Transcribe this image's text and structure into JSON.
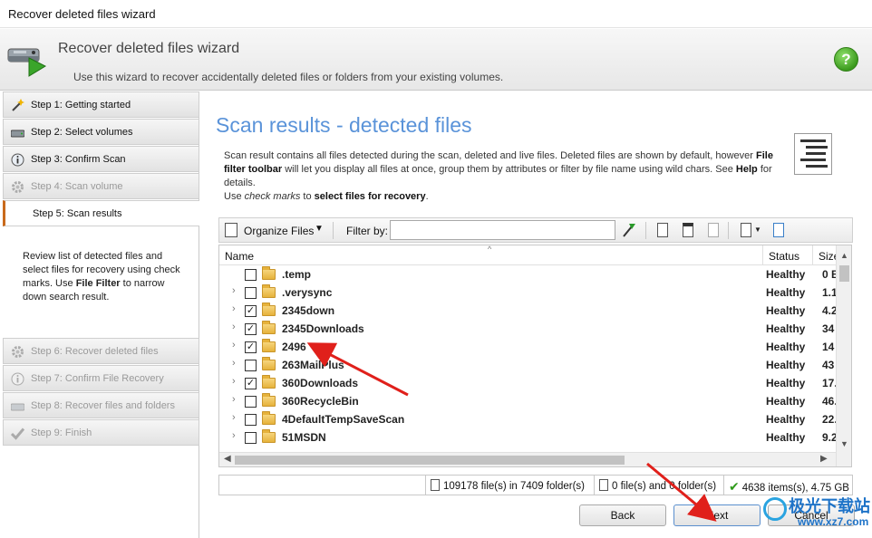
{
  "window": {
    "title": "Recover deleted files wizard"
  },
  "header": {
    "title": "Recover deleted files wizard",
    "subtitle": "Use this wizard to recover accidentally deleted files or folders from your existing volumes."
  },
  "steps": [
    {
      "label": "Step 1: Getting started",
      "state": "done",
      "icon": "wand-icon"
    },
    {
      "label": "Step 2: Select volumes",
      "state": "done",
      "icon": "drive-icon"
    },
    {
      "label": "Step 3: Confirm Scan",
      "state": "done",
      "icon": "info-icon"
    },
    {
      "label": "Step 4: Scan volume",
      "state": "disabled",
      "icon": "gear-icon"
    },
    {
      "label": "Step 5: Scan results",
      "state": "active",
      "icon": ""
    },
    {
      "label": "Step 6: Recover deleted files",
      "state": "disabled",
      "icon": "gear-icon"
    },
    {
      "label": "Step 7: Confirm File Recovery",
      "state": "disabled",
      "icon": "info-icon"
    },
    {
      "label": "Step 8: Recover files and folders",
      "state": "disabled",
      "icon": "drive-icon"
    },
    {
      "label": "Step 9: Finish",
      "state": "disabled",
      "icon": "check-icon"
    }
  ],
  "sidebar_desc": {
    "part1": "Review list of detected files and select files for recovery using check marks. Use ",
    "bold": "File Filter",
    "part2": " to narrow down search result."
  },
  "content": {
    "title": "Scan results - detected files",
    "desc": {
      "p1": "Scan result contains all files detected during the scan, deleted and live files. Deleted files are shown by default, however ",
      "b1": "File filter toolbar",
      "p2": " will let you display all files at once, group them by attributes or filter by file name using wild chars. See ",
      "b2": "Help",
      "p3": " for details.",
      "p4": "Use ",
      "i1": "check marks",
      "p5": " to ",
      "b3": "select files for recovery",
      "p6": "."
    }
  },
  "toolbar": {
    "organize_label": "Organize Files",
    "filter_label": "Filter by:",
    "filter_value": ""
  },
  "list": {
    "columns": {
      "name": "Name",
      "status": "Status",
      "size": "Size"
    },
    "rows": [
      {
        "name": ".temp",
        "checked": false,
        "expandable": false,
        "status": "Healthy",
        "size": "0 B"
      },
      {
        "name": ".verysync",
        "checked": false,
        "expandable": true,
        "status": "Healthy",
        "size": "1.1"
      },
      {
        "name": "2345down",
        "checked": true,
        "expandable": true,
        "status": "Healthy",
        "size": "4.2"
      },
      {
        "name": "2345Downloads",
        "checked": true,
        "expandable": true,
        "status": "Healthy",
        "size": "34"
      },
      {
        "name": "2496",
        "checked": true,
        "expandable": true,
        "status": "Healthy",
        "size": "14"
      },
      {
        "name": "263MailPlus",
        "checked": false,
        "expandable": true,
        "status": "Healthy",
        "size": "43"
      },
      {
        "name": "360Downloads",
        "checked": true,
        "expandable": true,
        "status": "Healthy",
        "size": "17."
      },
      {
        "name": "360RecycleBin",
        "checked": false,
        "expandable": true,
        "status": "Healthy",
        "size": "46."
      },
      {
        "name": "4DefaultTempSaveScan",
        "checked": false,
        "expandable": true,
        "status": "Healthy",
        "size": "22."
      },
      {
        "name": "51MSDN",
        "checked": false,
        "expandable": true,
        "status": "Healthy",
        "size": "9.2"
      }
    ]
  },
  "statusbar": {
    "total": "109178 file(s) in 7409 folder(s)",
    "selected": "0 file(s) and 0 folder(s)",
    "checked": "4638 items(s), 4.75 GB"
  },
  "buttons": {
    "back": "Back",
    "next": "Next",
    "cancel": "Cancel"
  },
  "watermark": {
    "text": "极光下载站",
    "url": "www.xz7.com"
  },
  "colors": {
    "title_blue": "#5a93d9",
    "help_green": "#3c9b1e",
    "arrow_red": "#e0201b",
    "active_step": "#c96a1b"
  }
}
